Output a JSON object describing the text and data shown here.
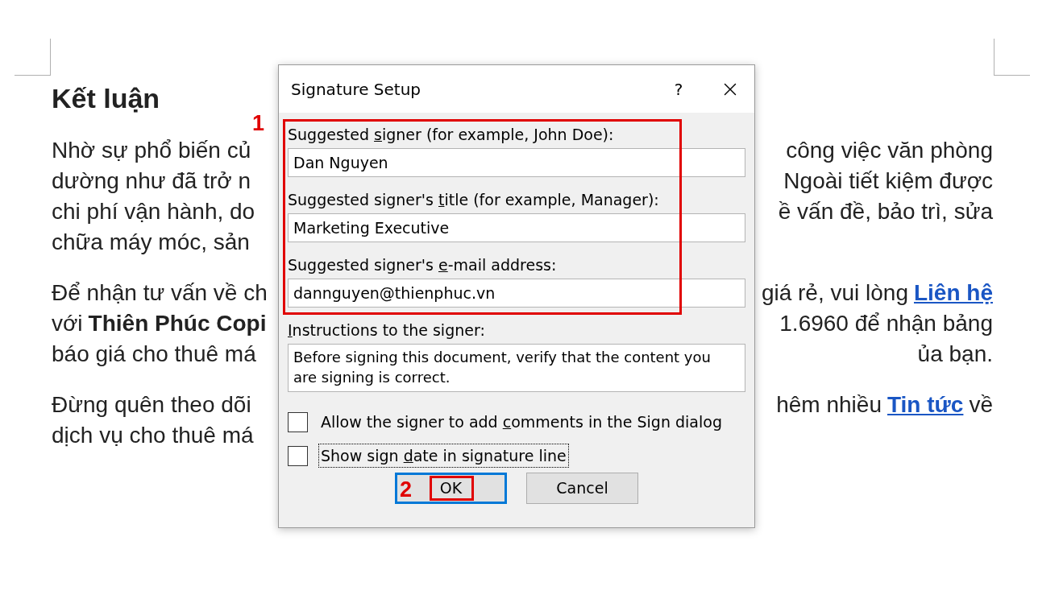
{
  "document": {
    "heading": "Kết luận",
    "paragraphs": [
      {
        "rows": [
          {
            "left": [
              {
                "kind": "plain",
                "text": "Nhờ sự phổ biến củ"
              }
            ],
            "right": [
              {
                "kind": "plain",
                "text": "công việc văn phòng"
              }
            ]
          },
          {
            "left": [
              {
                "kind": "plain",
                "text": "dường như đã trở n"
              }
            ],
            "right": [
              {
                "kind": "plain",
                "text": "Ngoài tiết kiệm được"
              }
            ]
          },
          {
            "left": [
              {
                "kind": "plain",
                "text": "chi phí vận hành, do"
              }
            ],
            "right": [
              {
                "kind": "plain",
                "text": "ề vấn đề, bảo trì, sửa"
              }
            ]
          },
          {
            "left": [
              {
                "kind": "plain",
                "text": "chữa máy móc, sản"
              }
            ]
          }
        ]
      },
      {
        "rows": [
          {
            "left": [
              {
                "kind": "plain",
                "text": "Để nhận tư vấn về ch"
              }
            ],
            "right": [
              {
                "kind": "plain",
                "text": "giá rẻ, vui lòng"
              },
              {
                "kind": "link",
                "text": "Liên hệ"
              }
            ]
          },
          {
            "left": [
              {
                "kind": "plain",
                "text": "với"
              },
              {
                "kind": "bold",
                "text": "Thiên Phúc Copi"
              }
            ],
            "right": [
              {
                "kind": "plain",
                "text": "1.6960 để nhận bảng"
              }
            ]
          },
          {
            "left": [
              {
                "kind": "plain",
                "text": "báo giá cho thuê má"
              }
            ],
            "right": [
              {
                "kind": "plain",
                "text": "ủa bạn."
              }
            ]
          }
        ]
      },
      {
        "rows": [
          {
            "left": [
              {
                "kind": "plain",
                "text": "Đừng quên theo dõi"
              }
            ],
            "right": [
              {
                "kind": "plain",
                "text": "hêm nhiều"
              },
              {
                "kind": "link",
                "text": "Tin tức"
              },
              {
                "kind": "plain",
                "text": "về"
              }
            ]
          },
          {
            "left": [
              {
                "kind": "plain",
                "text": "dịch vụ cho thuê má"
              }
            ]
          }
        ]
      }
    ]
  },
  "dialog": {
    "title": "Signature Setup",
    "help": "?",
    "fields": [
      {
        "kind": "line",
        "label": {
          "before": "Suggested ",
          "key": "s",
          "after": "igner (for example, John Doe):"
        },
        "value": "Dan Nguyen"
      },
      {
        "kind": "line",
        "label": {
          "before": "Suggested signer's ",
          "key": "t",
          "after": "itle (for example, Manager):"
        },
        "value": "Marketing Executive"
      },
      {
        "kind": "line",
        "label": {
          "before": "Suggested signer's ",
          "key": "e",
          "after": "-mail address:"
        },
        "value": "dannguyen@thienphuc.vn"
      },
      {
        "kind": "multiline",
        "label": {
          "key": "I",
          "after": "nstructions to the signer:"
        },
        "value": "Before signing this document, verify that the content you are signing is correct."
      }
    ],
    "checkboxes": [
      {
        "label": {
          "before": "Allow the signer to add ",
          "key": "c",
          "after": "omments in the Sign dialog"
        },
        "checked": false,
        "focused": false
      },
      {
        "label": {
          "before": "Show sign ",
          "key": "d",
          "after": "ate in signature line"
        },
        "checked": false,
        "focused": true
      }
    ],
    "buttons": [
      {
        "label": "OK",
        "default": true
      },
      {
        "label": "Cancel",
        "default": false
      }
    ]
  },
  "annotations": [
    {
      "label": "1"
    },
    {
      "label": "2"
    }
  ]
}
